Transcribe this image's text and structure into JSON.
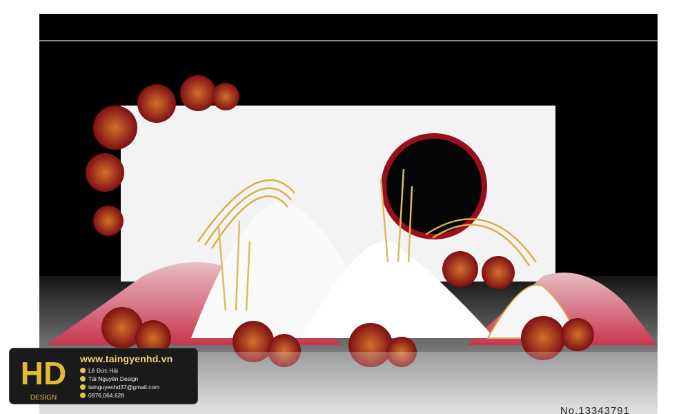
{
  "image": {
    "description_colors": {
      "backdrop": "#000000",
      "panel": "#f4f4f4",
      "accent_red": "#c83a4d",
      "gold": "#d6b14a"
    }
  },
  "watermark": {
    "text": "No.13343791"
  },
  "badge": {
    "logo_text": "HD",
    "logo_sub": "DESIGN",
    "website": "www.taingyenhd.vn",
    "lines": [
      "Lê Đức Hải",
      "Tài Nguyên Design",
      "tainguyenhd37@gmail.com",
      "0976.064.628"
    ],
    "icons": [
      "facebook-icon",
      "youtube-icon",
      "email-icon",
      "phone-icon"
    ]
  }
}
